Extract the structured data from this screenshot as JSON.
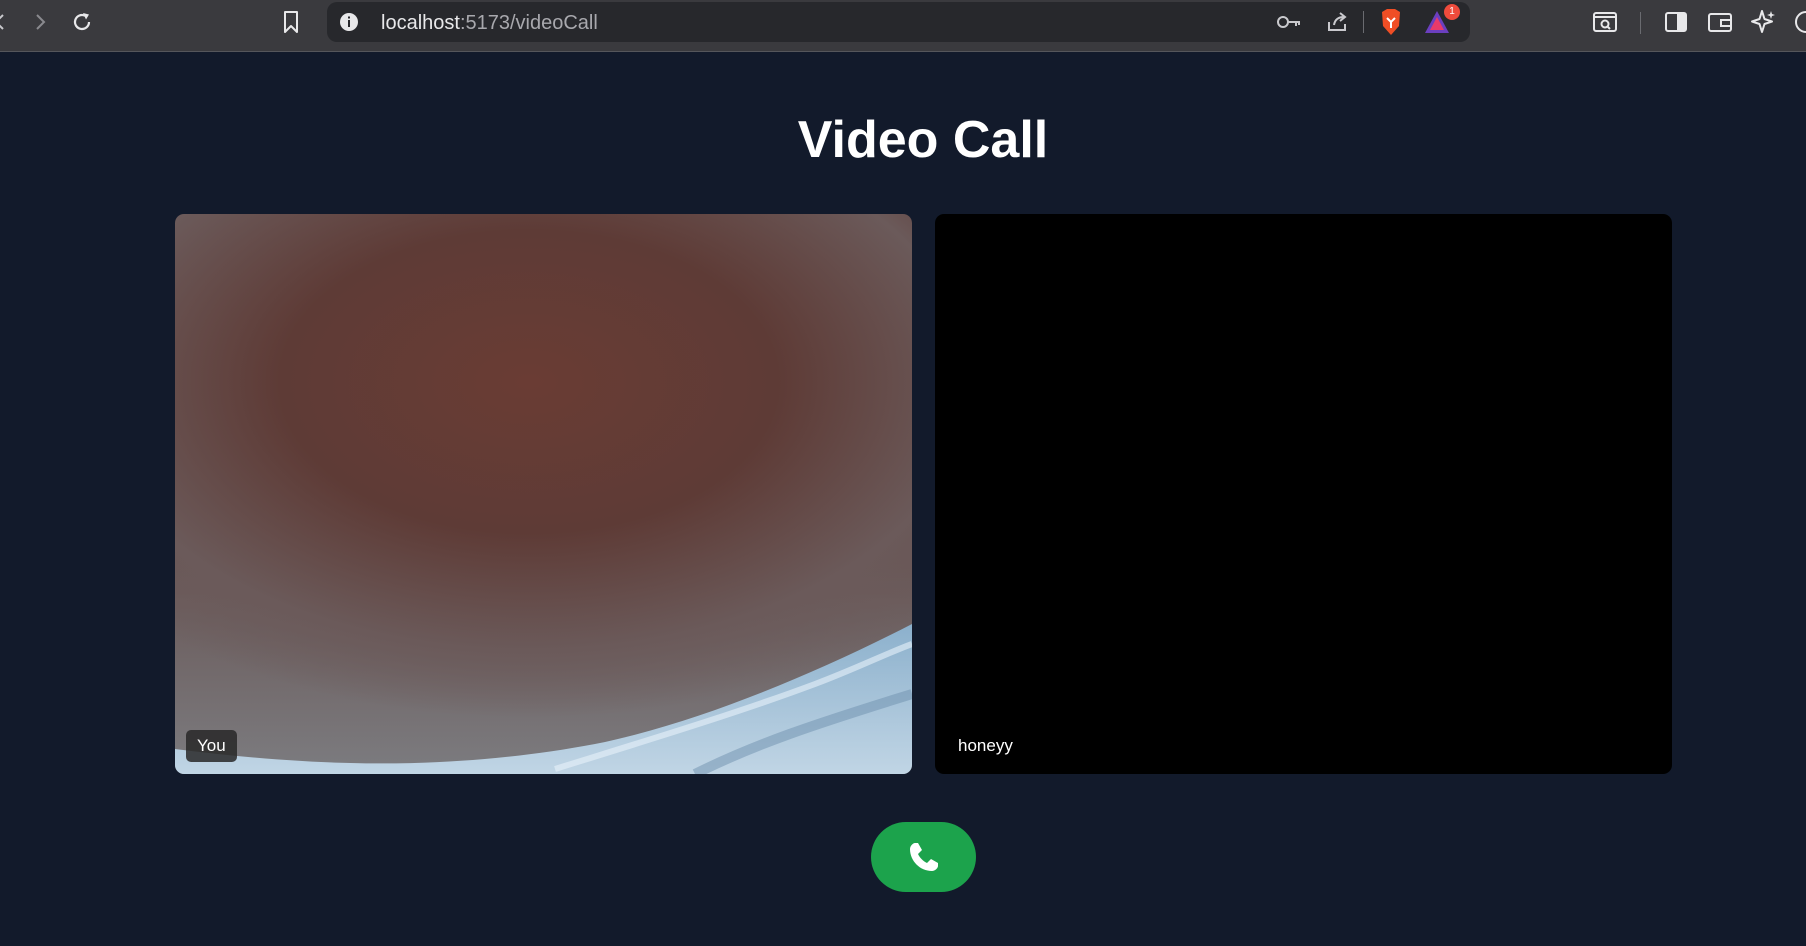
{
  "browser": {
    "url_host": "localhost",
    "url_path": ":5173/videoCall",
    "notification_count": "1",
    "icons": [
      "back-icon",
      "forward-icon",
      "reload-icon",
      "bookmark-icon",
      "site-info-icon",
      "password-key-icon",
      "share-icon",
      "brave-shields-icon",
      "brave-rewards-icon",
      "page-search-icon",
      "sidebar-icon",
      "wallet-icon",
      "leo-ai-icon"
    ]
  },
  "page": {
    "title": "Video Call"
  },
  "videos": [
    {
      "label": "You"
    },
    {
      "label": "honeyy"
    }
  ],
  "controls": {
    "call_icon": "phone-icon",
    "call_color": "#1ca34c"
  },
  "colors": {
    "background": "#121a2b",
    "remote_video": "#000000"
  }
}
